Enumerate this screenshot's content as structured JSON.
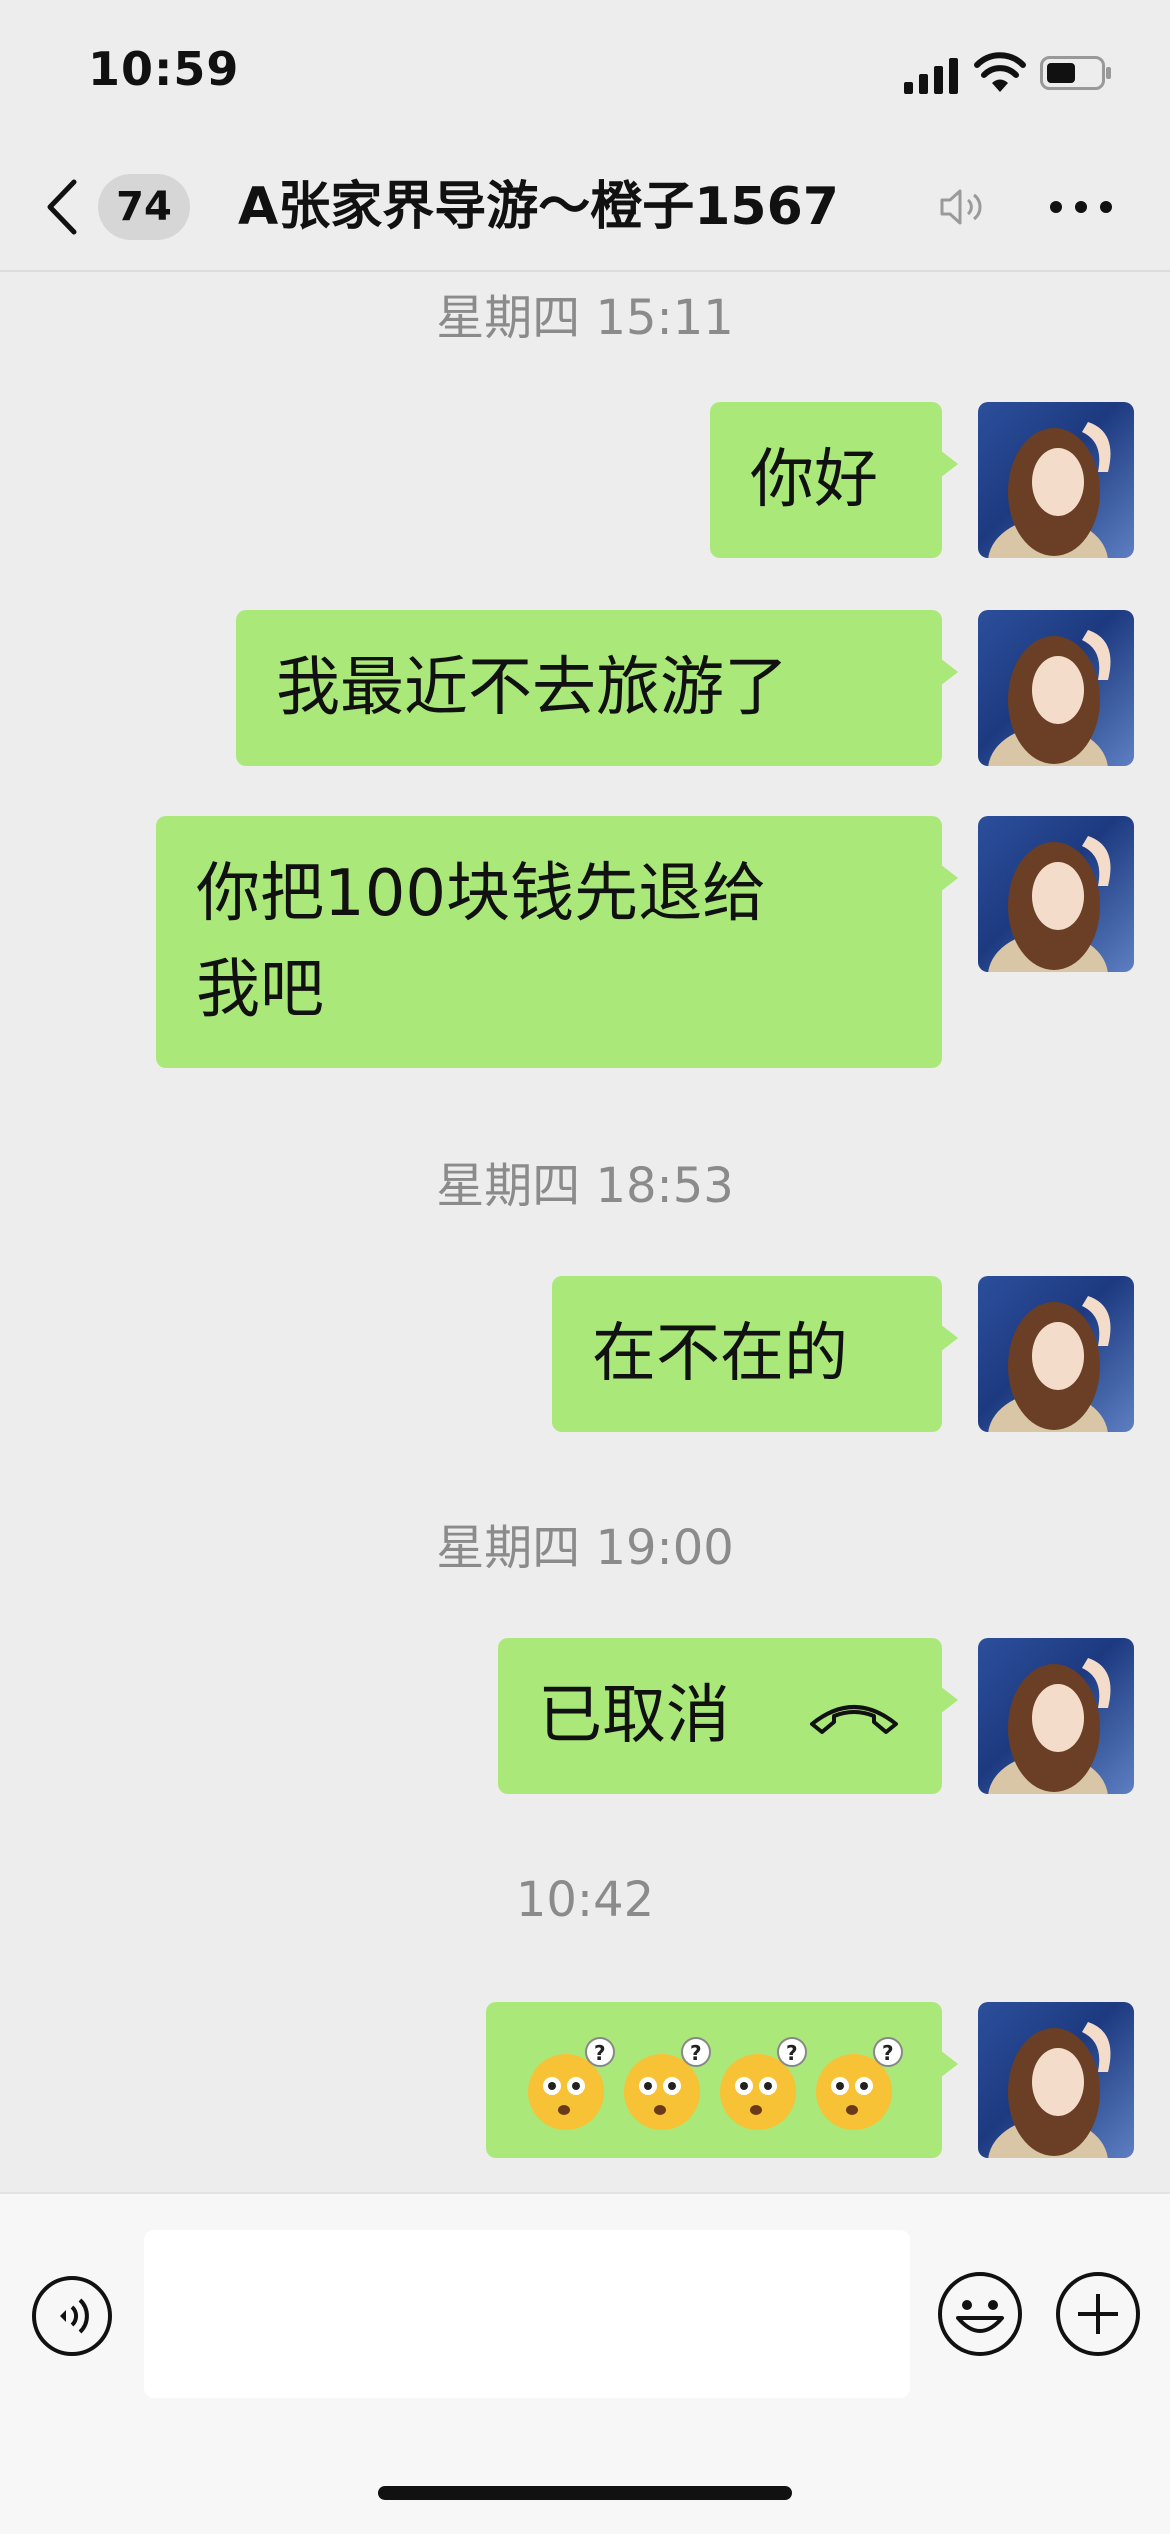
{
  "status_bar": {
    "time": "10:59"
  },
  "nav": {
    "unread_count": "74",
    "title": "A张家界导游～橙子1567",
    "mute_icon": "muted-speaker-icon",
    "more_icon": "more-dots-icon"
  },
  "messages": [
    {
      "type": "timestamp",
      "text": "星期四 15:11"
    },
    {
      "type": "text",
      "from": "me",
      "text": "你好"
    },
    {
      "type": "text",
      "from": "me",
      "text": "我最近不去旅游了"
    },
    {
      "type": "text",
      "from": "me",
      "line1": "你把100块钱先退给",
      "line2": "我吧"
    },
    {
      "type": "timestamp",
      "text": "星期四 18:53"
    },
    {
      "type": "text",
      "from": "me",
      "text": "在不在的"
    },
    {
      "type": "timestamp",
      "text": "星期四 19:00"
    },
    {
      "type": "call",
      "from": "me",
      "text": "已取消",
      "icon": "phone-hangup-icon"
    },
    {
      "type": "timestamp",
      "text": "10:42"
    },
    {
      "type": "emoji",
      "from": "me",
      "emoji": "confused-face-question-emoji",
      "count": 4
    }
  ],
  "input_bar": {
    "voice_icon": "voice-input-icon",
    "emoji_icon": "emoji-smile-icon",
    "plus_icon": "plus-circle-icon"
  },
  "colors": {
    "background": "#ededed",
    "bubble": "#a9e879",
    "timestamp": "#8b8b8b"
  }
}
